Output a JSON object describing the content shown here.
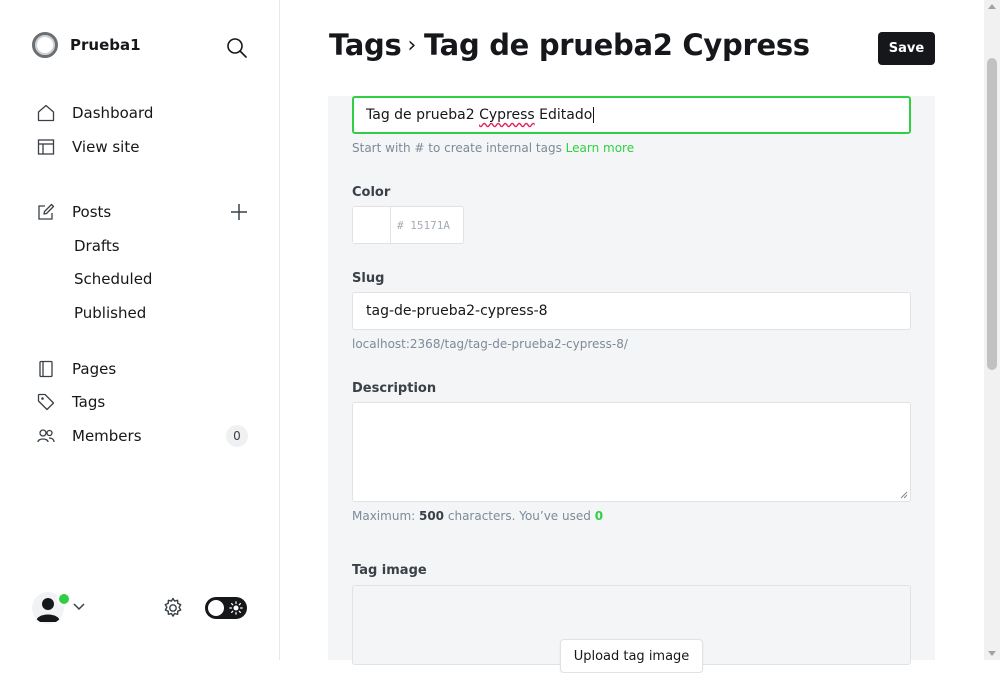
{
  "brand": {
    "name": "Prueba1"
  },
  "sidebar": {
    "nav": [
      {
        "label": "Dashboard",
        "icon": "home-icon"
      },
      {
        "label": "View site",
        "icon": "layout-icon"
      }
    ],
    "posts": {
      "label": "Posts",
      "icon": "edit-icon",
      "sub": [
        "Drafts",
        "Scheduled",
        "Published"
      ]
    },
    "nav2": [
      {
        "label": "Pages",
        "icon": "page-icon"
      },
      {
        "label": "Tags",
        "icon": "tag-icon"
      },
      {
        "label": "Members",
        "icon": "members-icon",
        "count": "0"
      }
    ]
  },
  "header": {
    "breadcrumb": "Tags",
    "separator": "›",
    "title": "Tag de prueba2 Cypress",
    "save_label": "Save"
  },
  "form": {
    "name_value_pre": "Tag de prueba2 ",
    "name_value_spell": "Cypress",
    "name_value_post": " Editado",
    "name_hint": "Start with # to create internal tags",
    "name_hint_link": "Learn more",
    "color_label": "Color",
    "color_hex": "# 15171A",
    "slug_label": "Slug",
    "slug_value": "tag-de-prueba2-cypress-8",
    "slug_url": "localhost:2368/tag/tag-de-prueba2-cypress-8/",
    "description_label": "Description",
    "desc_hint_pre": "Maximum: ",
    "desc_hint_max": "500",
    "desc_hint_mid": " characters. You’ve used ",
    "desc_hint_used": "0",
    "image_label": "Tag image",
    "upload_label": "Upload tag image"
  },
  "colors": {
    "accent": "#30cf43",
    "dark": "#15171a"
  }
}
